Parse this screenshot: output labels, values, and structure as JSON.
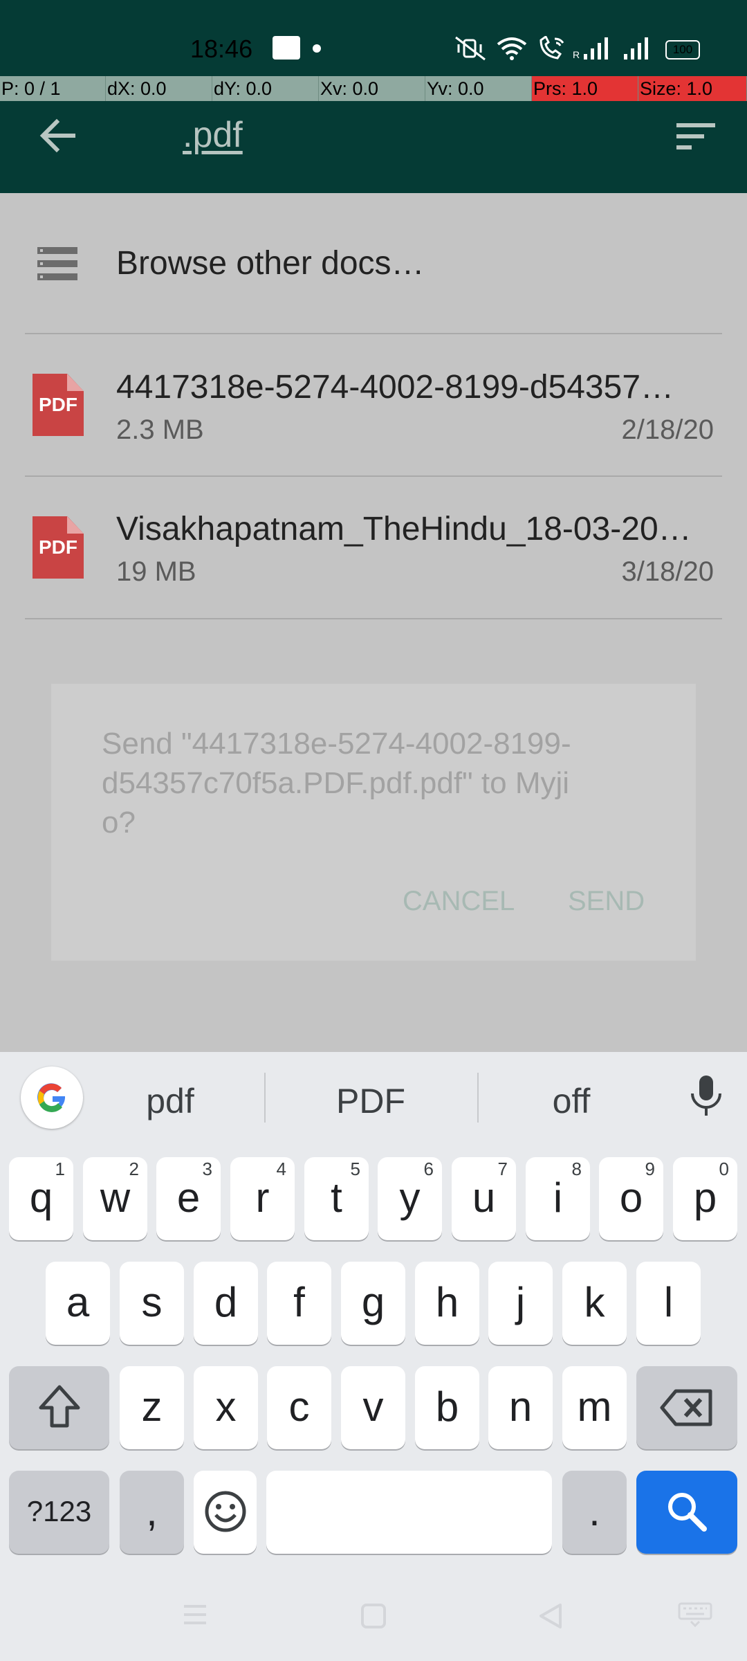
{
  "status_bar": {
    "time": "18:46",
    "notification_icon": "zomato-icon",
    "icons": [
      "mute-vibrate-icon",
      "wifi-icon",
      "wifi-calling-icon",
      "signal-r-icon",
      "signal-icon",
      "battery-icon"
    ],
    "battery": "100"
  },
  "pointer_overlay": {
    "p": "P: 0 / 1",
    "dx": "dX: 0.0",
    "dy": "dY: 0.0",
    "xv": "Xv: 0.0",
    "yv": "Yv: 0.0",
    "prs": "Prs: 1.0",
    "size": "Size: 1.0"
  },
  "toolbar": {
    "title": ".pdf",
    "back_icon": "arrow-left-icon",
    "sort_icon": "sort-icon"
  },
  "list": {
    "browse": "Browse other docs…",
    "files": [
      {
        "name": "4417318e-5274-4002-8199-d54357…",
        "size": "2.3 MB",
        "date": "2/18/20",
        "icon_label": "PDF"
      },
      {
        "name": "Visakhapatnam_TheHindu_18-03-20…",
        "size": "19 MB",
        "date": "3/18/20",
        "icon_label": "PDF"
      }
    ]
  },
  "dialog": {
    "message": "Send \"4417318e-5274-4002-8199-d54357c70f5a.PDF.pdf.pdf\" to Myjio?",
    "cancel": "CANCEL",
    "send": "SEND"
  },
  "keyboard": {
    "suggestions": [
      "pdf",
      "PDF",
      "off"
    ],
    "row1": [
      {
        "k": "q",
        "s": "1"
      },
      {
        "k": "w",
        "s": "2"
      },
      {
        "k": "e",
        "s": "3"
      },
      {
        "k": "r",
        "s": "4"
      },
      {
        "k": "t",
        "s": "5"
      },
      {
        "k": "y",
        "s": "6"
      },
      {
        "k": "u",
        "s": "7"
      },
      {
        "k": "i",
        "s": "8"
      },
      {
        "k": "o",
        "s": "9"
      },
      {
        "k": "p",
        "s": "0"
      }
    ],
    "row2": [
      "a",
      "s",
      "d",
      "f",
      "g",
      "h",
      "j",
      "k",
      "l"
    ],
    "row3": [
      "z",
      "x",
      "c",
      "v",
      "b",
      "n",
      "m"
    ],
    "symbols": "?123",
    "comma": ",",
    "period": ".",
    "accent": "#1a73e8"
  }
}
